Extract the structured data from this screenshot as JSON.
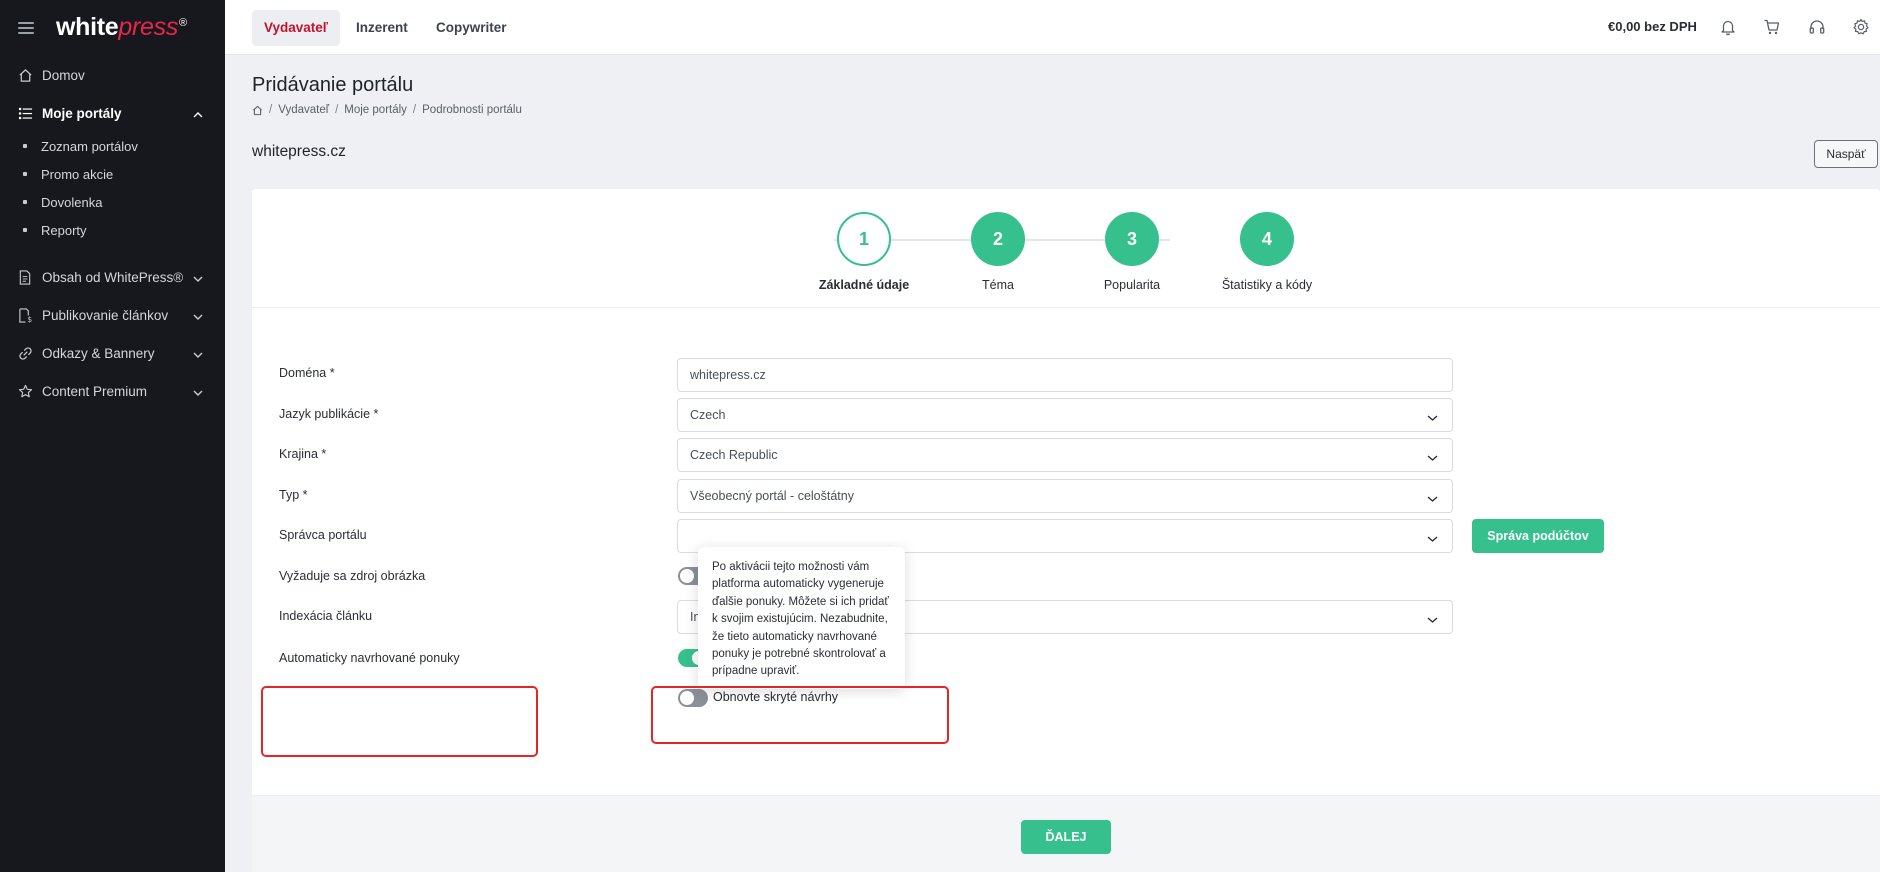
{
  "app": {
    "logo": {
      "main": "white",
      "accent": "press",
      "reg": "®"
    }
  },
  "sidebar": {
    "items": [
      {
        "label": "Domov",
        "icon": "home-icon"
      },
      {
        "label": "Moje portály",
        "icon": "list-icon",
        "active": true
      },
      {
        "label": "Obsah od WhitePress®",
        "icon": "document-icon"
      },
      {
        "label": "Publikovanie článkov",
        "icon": "publish-icon"
      },
      {
        "label": "Odkazy & Bannery",
        "icon": "link-icon"
      },
      {
        "label": "Content Premium",
        "icon": "star-icon"
      }
    ],
    "subitems": [
      {
        "label": "Zoznam portálov"
      },
      {
        "label": "Promo akcie"
      },
      {
        "label": "Dovolenka"
      },
      {
        "label": "Reporty"
      }
    ]
  },
  "topbar": {
    "tabs": [
      {
        "label": "Vydavateľ",
        "active": true
      },
      {
        "label": "Inzerent"
      },
      {
        "label": "Copywriter"
      }
    ],
    "balance": "€0,00 bez DPH",
    "icons": [
      "bell-icon",
      "cart-icon",
      "headset-icon",
      "gear-icon"
    ]
  },
  "page": {
    "title": "Pridávanie portálu",
    "breadcrumb": [
      "Vydavateľ",
      "Moje portály",
      "Podrobnosti portálu"
    ],
    "site_name": "whitepress.cz",
    "back_label": "Naspäť"
  },
  "stepper": {
    "steps": [
      {
        "num": "1",
        "label": "Základné údaje",
        "state": "current"
      },
      {
        "num": "2",
        "label": "Téma",
        "state": "future"
      },
      {
        "num": "3",
        "label": "Popularita",
        "state": "future"
      },
      {
        "num": "4",
        "label": "Štatistiky a kódy",
        "state": "future"
      }
    ]
  },
  "form": {
    "domain": {
      "label": "Doména *",
      "value": "whitepress.cz"
    },
    "language": {
      "label": "Jazyk publikácie *",
      "value": "Czech"
    },
    "country": {
      "label": "Krajina *",
      "value": "Czech Republic"
    },
    "type": {
      "label": "Typ *",
      "value": "Všeobecný portál - celoštátny"
    },
    "manager": {
      "label": "Správca portálu",
      "value": "",
      "button": "Správa podúčtov"
    },
    "image_source": {
      "label": "Vyžaduje sa zdroj obrázka",
      "enabled": false
    },
    "indexation": {
      "label": "Indexácia článku",
      "value": "In"
    },
    "auto_offers": {
      "label": "Automaticky navrhované ponuky",
      "enabled": true
    },
    "restore_hidden": {
      "label": "Obnovte skryté návrhy",
      "enabled": false
    }
  },
  "tooltip": {
    "text": "Po aktivácii tejto možnosti vám platforma automaticky vygeneruje ďalšie ponuky. Môžete si ich pridať k svojim existujúcim. Nezabudnite, že tieto automaticky navrhované ponuky je potrebné skontrolovať a prípadne upraviť."
  },
  "footer": {
    "next_label": "ĎALEJ"
  },
  "colors": {
    "accent": "#36c08e",
    "brand_red": "#c8102e",
    "highlight": "#e32626",
    "sidebar_bg": "#16181d"
  }
}
